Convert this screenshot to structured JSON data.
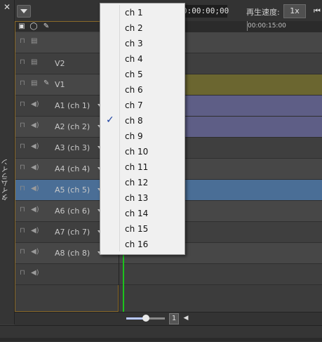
{
  "panel": {
    "title": "タイムライン",
    "close_icon": "close-icon"
  },
  "toolbar": {
    "timecode": "0:00:00;00",
    "speed_label": "再生速度:",
    "speed_value": "1x"
  },
  "ruler": {
    "mark_label": "00:00:15:00"
  },
  "header_icons": [
    "lock-icon",
    "sync-icon",
    "pen-icon"
  ],
  "tracks": [
    {
      "name": "",
      "type": "video"
    },
    {
      "name": "V2",
      "type": "video"
    },
    {
      "name": "V1",
      "type": "video",
      "clip_color": "#6b6630"
    },
    {
      "name": "A1 (ch 1)",
      "type": "audio",
      "clip_color": "#5e5e86"
    },
    {
      "name": "A2 (ch 2)",
      "type": "audio",
      "clip_color": "#5e5e86"
    },
    {
      "name": "A3 (ch 3)",
      "type": "audio"
    },
    {
      "name": "A4 (ch 4)",
      "type": "audio"
    },
    {
      "name": "A5 (ch 5)",
      "type": "audio",
      "selected": true
    },
    {
      "name": "A6 (ch 6)",
      "type": "audio"
    },
    {
      "name": "A7 (ch 7)",
      "type": "audio"
    },
    {
      "name": "A8 (ch 8)",
      "type": "audio"
    },
    {
      "name": "",
      "type": "audio"
    }
  ],
  "channel_menu": {
    "items": [
      "ch 1",
      "ch 2",
      "ch 3",
      "ch 4",
      "ch 5",
      "ch 6",
      "ch 7",
      "ch 8",
      "ch 9",
      "ch 10",
      "ch 11",
      "ch 12",
      "ch 13",
      "ch 14",
      "ch 15",
      "ch 16"
    ],
    "checked": "ch 8"
  },
  "zoom": {
    "page": "1",
    "level": 0.5
  },
  "colors": {
    "selected_row": "#4a6e96",
    "playhead": "#1cc21c",
    "accent_border": "#8a6a2a"
  }
}
